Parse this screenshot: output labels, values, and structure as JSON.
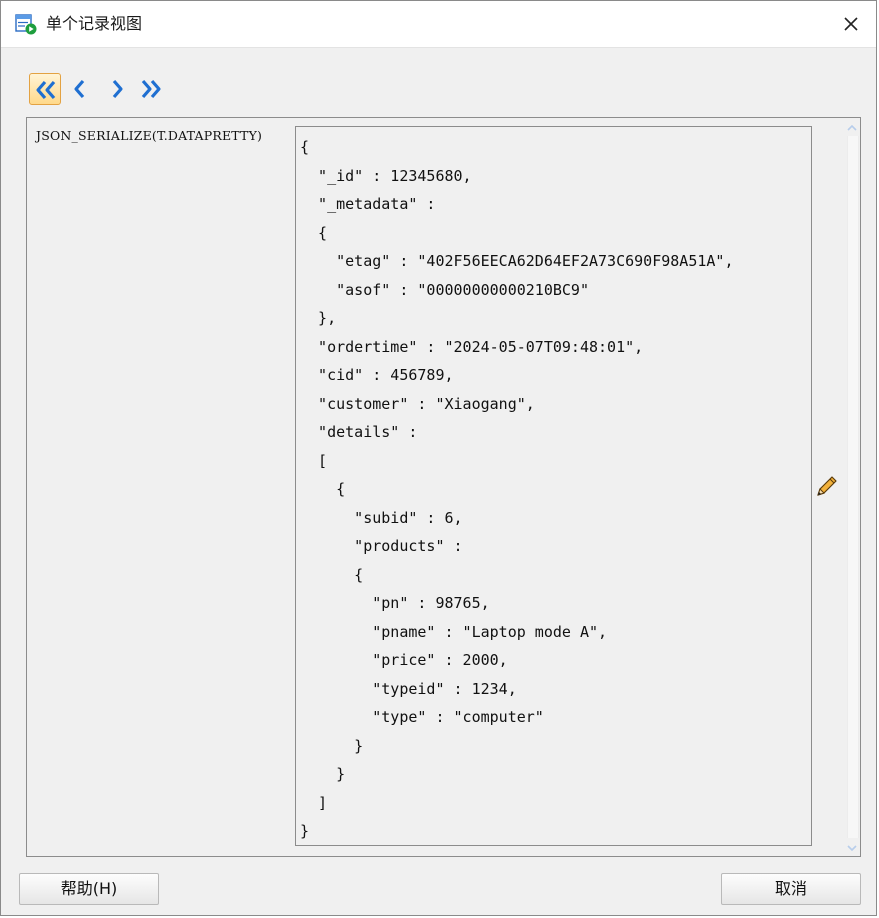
{
  "window": {
    "title": "单个记录视图",
    "icon": "record-view-icon",
    "close_icon": "close-icon"
  },
  "nav": {
    "buttons": [
      {
        "name": "first-record-button",
        "icon": "double-chevron-left-icon",
        "active": true
      },
      {
        "name": "previous-record-button",
        "icon": "chevron-left-icon",
        "active": false
      },
      {
        "name": "next-record-button",
        "icon": "chevron-right-icon",
        "active": false
      },
      {
        "name": "last-record-button",
        "icon": "double-chevron-right-icon",
        "active": false
      }
    ]
  },
  "record": {
    "field_label": "JSON_SERIALIZE(T.DATAPRETTY)",
    "value": "{\n  \"_id\" : 12345680,\n  \"_metadata\" :\n  {\n    \"etag\" : \"402F56EECA62D64EF2A73C690F98A51A\",\n    \"asof\" : \"00000000000210BC9\"\n  },\n  \"ordertime\" : \"2024-05-07T09:48:01\",\n  \"cid\" : 456789,\n  \"customer\" : \"Xiaogang\",\n  \"details\" :\n  [\n    {\n      \"subid\" : 6,\n      \"products\" :\n      {\n        \"pn\" : 98765,\n        \"pname\" : \"Laptop mode A\",\n        \"price\" : 2000,\n        \"typeid\" : 1234,\n        \"type\" : \"computer\"\n      }\n    }\n  ]\n}",
    "edit_icon": "pencil-icon"
  },
  "buttons": {
    "help_label": "帮助(H)",
    "cancel_label": "取消"
  },
  "colors": {
    "accent_border": "#e3a242",
    "arrow_blue": "#1f6fd1"
  }
}
